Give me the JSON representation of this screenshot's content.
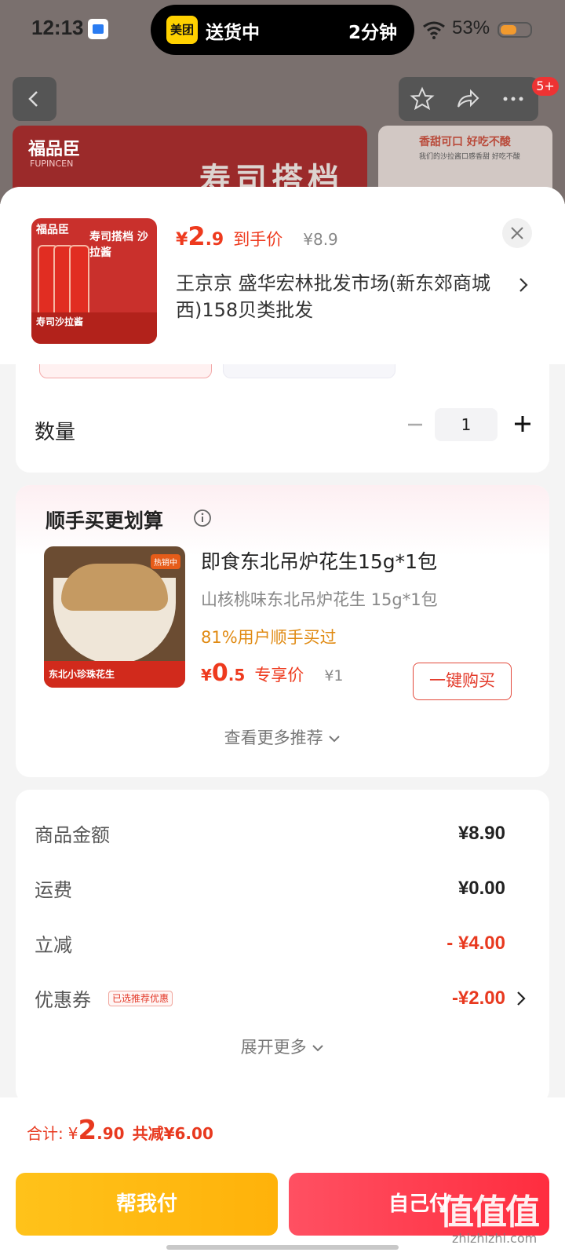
{
  "status_bar": {
    "time": "12:13",
    "island_app": "美团",
    "island_status": "送货中",
    "island_eta": "2分钟",
    "battery": "53%"
  },
  "background": {
    "more_badge": "5+",
    "banner_brand": "福品臣",
    "banner_brand_sub": "FUPINCEN",
    "banner_title": "寿司搭档",
    "side_banner_title": "香甜可口  好吃不酸",
    "side_banner_sub": "我们的沙拉酱口感香甜 好吃不酸"
  },
  "product": {
    "thumb_brand": "福品臣",
    "thumb_title": "寿司搭档 沙拉酱",
    "thumb_footer": "寿司沙拉酱",
    "price_symbol": "¥",
    "price_int": "2",
    "price_dec": ".9",
    "price_tag": "到手价",
    "original_price": "¥8.9",
    "store": "王京京  盛华宏林批发市场(新东郊商城西)158贝类批发"
  },
  "quantity": {
    "label": "数量",
    "value": "1"
  },
  "recommend": {
    "title": "顺手买更划算",
    "item": {
      "hot_badge": "热销中",
      "img_footer": "东北小珍珠花生",
      "name": "即食东北吊炉花生15g*1包",
      "sub": "山核桃味东北吊炉花生   15g*1包",
      "bought": "81%用户顺手买过",
      "price_symbol": "¥",
      "price_int": "0",
      "price_dec": ".5",
      "price_tag": "专享价",
      "original_price": "¥1",
      "buy_label": "一键购买"
    },
    "more": "查看更多推荐"
  },
  "summary": {
    "rows": [
      {
        "label": "商品金额",
        "value": "¥8.90"
      },
      {
        "label": "运费",
        "value": "¥0.00"
      },
      {
        "label": "立减",
        "value": "- ¥4.00"
      },
      {
        "label": "优惠券",
        "value": "-¥2.00",
        "tag": "已选推荐优惠"
      }
    ],
    "expand": "展开更多"
  },
  "footer": {
    "total_label": "合计:",
    "total_symbol": "¥",
    "total_int": "2",
    "total_dec": ".90",
    "saved": "共减¥6.00",
    "help_pay": "帮我付",
    "self_pay": "自己付"
  },
  "watermark": {
    "main": "值值值",
    "sub": "zhizhizhi.com"
  },
  "colors": {
    "accent_red": "#ee3a1e",
    "help_yellow": "#ffb20a",
    "pay_red": "#ff2d3f",
    "bought_orange": "#e08a12"
  }
}
